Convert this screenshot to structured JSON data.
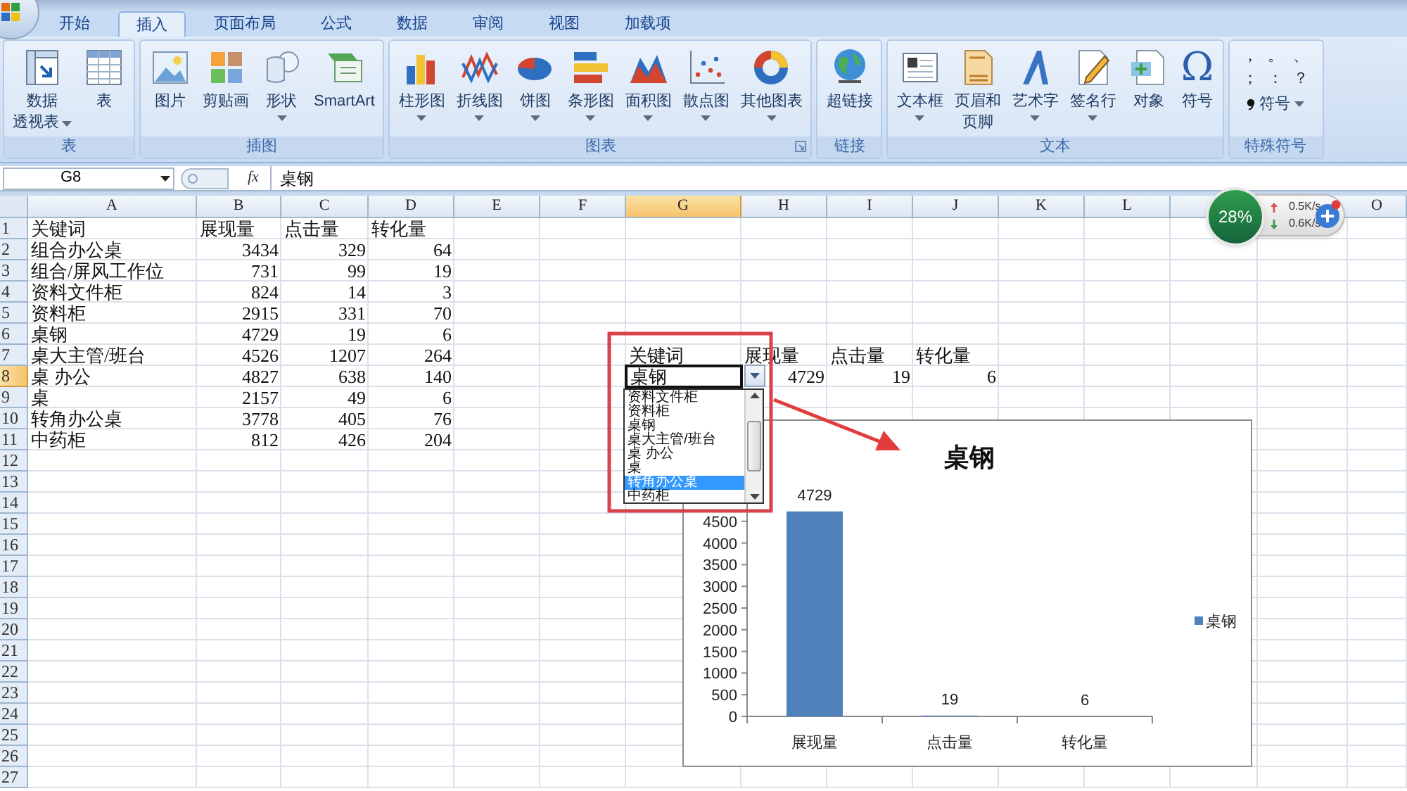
{
  "ribbon": {
    "tabs": [
      {
        "label": "开始",
        "selected": false
      },
      {
        "label": "插入",
        "selected": true
      },
      {
        "label": "页面布局",
        "selected": false
      },
      {
        "label": "公式",
        "selected": false
      },
      {
        "label": "数据",
        "selected": false
      },
      {
        "label": "审阅",
        "selected": false
      },
      {
        "label": "视图",
        "selected": false
      },
      {
        "label": "加载项",
        "selected": false
      }
    ],
    "groups": [
      {
        "label": "表",
        "kind": "buttons",
        "launcher": false,
        "buttons": [
          {
            "lines": [
              "数据",
              "透视表"
            ],
            "dropdown": true
          },
          {
            "lines": [
              "表"
            ],
            "dropdown": false
          }
        ]
      },
      {
        "label": "插图",
        "kind": "buttons",
        "launcher": false,
        "buttons": [
          {
            "lines": [
              "图片"
            ],
            "dropdown": false
          },
          {
            "lines": [
              "剪贴画"
            ],
            "dropdown": false
          },
          {
            "lines": [
              "形状"
            ],
            "dropdown": true
          },
          {
            "lines": [
              "SmartArt"
            ],
            "dropdown": false
          }
        ]
      },
      {
        "label": "图表",
        "kind": "buttons",
        "launcher": true,
        "buttons": [
          {
            "lines": [
              "柱形图"
            ],
            "dropdown": true
          },
          {
            "lines": [
              "折线图"
            ],
            "dropdown": true
          },
          {
            "lines": [
              "饼图"
            ],
            "dropdown": true
          },
          {
            "lines": [
              "条形图"
            ],
            "dropdown": true
          },
          {
            "lines": [
              "面积图"
            ],
            "dropdown": true
          },
          {
            "lines": [
              "散点图"
            ],
            "dropdown": true
          },
          {
            "lines": [
              "其他图表"
            ],
            "dropdown": true
          }
        ]
      },
      {
        "label": "链接",
        "kind": "buttons",
        "launcher": false,
        "buttons": [
          {
            "lines": [
              "超链接"
            ],
            "dropdown": false
          }
        ]
      },
      {
        "label": "文本",
        "kind": "buttons",
        "launcher": false,
        "buttons": [
          {
            "lines": [
              "文本框"
            ],
            "dropdown": true
          },
          {
            "lines": [
              "页眉和",
              "页脚"
            ],
            "dropdown": false
          },
          {
            "lines": [
              "艺术字"
            ],
            "dropdown": true
          },
          {
            "lines": [
              "签名行"
            ],
            "dropdown": true
          },
          {
            "lines": [
              "对象"
            ],
            "dropdown": false
          },
          {
            "lines": [
              "符号"
            ],
            "dropdown": false,
            "glyph": "Ω"
          }
        ]
      },
      {
        "label": "特殊符号",
        "kind": "symbols",
        "launcher": false,
        "symbols": [
          "，",
          "。",
          "、",
          "；",
          "：",
          "？"
        ],
        "button": {
          "label": "符号",
          "dropdown": true
        }
      }
    ]
  },
  "formula_bar": {
    "cell": "G8",
    "function_button": "fx",
    "content": "桌钢"
  },
  "sheet": {
    "columns": [
      {
        "label": "A",
        "selected": false
      },
      {
        "label": "B",
        "selected": false
      },
      {
        "label": "C",
        "selected": false
      },
      {
        "label": "D",
        "selected": false
      },
      {
        "label": "E",
        "selected": false
      },
      {
        "label": "F",
        "selected": false
      },
      {
        "label": "G",
        "selected": true
      },
      {
        "label": "H",
        "selected": false
      },
      {
        "label": "I",
        "selected": false
      },
      {
        "label": "J",
        "selected": false
      },
      {
        "label": "K",
        "selected": false
      },
      {
        "label": "L",
        "selected": false
      },
      {
        "label": "O",
        "selected": false
      }
    ],
    "rows": [
      {
        "label": "1",
        "selected": false,
        "cells": [
          {
            "text": "关键词",
            "kind": "text"
          },
          {
            "text": "展现量",
            "kind": "text"
          },
          {
            "text": "点击量",
            "kind": "text"
          },
          {
            "text": "转化量",
            "kind": "text"
          }
        ]
      },
      {
        "label": "2",
        "selected": false,
        "cells": [
          {
            "text": "组合办公桌",
            "kind": "text"
          },
          {
            "text": "3434",
            "kind": "number"
          },
          {
            "text": "329",
            "kind": "number"
          },
          {
            "text": "64",
            "kind": "number"
          }
        ]
      },
      {
        "label": "3",
        "selected": false,
        "cells": [
          {
            "text": "组合/屏风工作位",
            "kind": "text"
          },
          {
            "text": "731",
            "kind": "number"
          },
          {
            "text": "99",
            "kind": "number"
          },
          {
            "text": "19",
            "kind": "number"
          }
        ]
      },
      {
        "label": "4",
        "selected": false,
        "cells": [
          {
            "text": "资料文件柜",
            "kind": "text"
          },
          {
            "text": "824",
            "kind": "number"
          },
          {
            "text": "14",
            "kind": "number"
          },
          {
            "text": "3",
            "kind": "number"
          }
        ]
      },
      {
        "label": "5",
        "selected": false,
        "cells": [
          {
            "text": "资料柜",
            "kind": "text"
          },
          {
            "text": "2915",
            "kind": "number"
          },
          {
            "text": "331",
            "kind": "number"
          },
          {
            "text": "70",
            "kind": "number"
          }
        ]
      },
      {
        "label": "6",
        "selected": false,
        "cells": [
          {
            "text": "桌钢",
            "kind": "text"
          },
          {
            "text": "4729",
            "kind": "number"
          },
          {
            "text": "19",
            "kind": "number"
          },
          {
            "text": "6",
            "kind": "number"
          }
        ]
      },
      {
        "label": "7",
        "selected": false,
        "cells": [
          {
            "text": "桌大主管/班台",
            "kind": "text"
          },
          {
            "text": "4526",
            "kind": "number"
          },
          {
            "text": "1207",
            "kind": "number"
          },
          {
            "text": "264",
            "kind": "number"
          }
        ]
      },
      {
        "label": "8",
        "selected": true,
        "cells": [
          {
            "text": "桌 办公",
            "kind": "text"
          },
          {
            "text": "4827",
            "kind": "number"
          },
          {
            "text": "638",
            "kind": "number"
          },
          {
            "text": "140",
            "kind": "number"
          }
        ]
      },
      {
        "label": "9",
        "selected": false,
        "cells": [
          {
            "text": "桌",
            "kind": "text"
          },
          {
            "text": "2157",
            "kind": "number"
          },
          {
            "text": "49",
            "kind": "number"
          },
          {
            "text": "6",
            "kind": "number"
          }
        ]
      },
      {
        "label": "10",
        "selected": false,
        "cells": [
          {
            "text": "转角办公桌",
            "kind": "text"
          },
          {
            "text": "3778",
            "kind": "number"
          },
          {
            "text": "405",
            "kind": "number"
          },
          {
            "text": "76",
            "kind": "number"
          }
        ]
      },
      {
        "label": "11",
        "selected": false,
        "cells": [
          {
            "text": "中药柜",
            "kind": "text"
          },
          {
            "text": "812",
            "kind": "number"
          },
          {
            "text": "426",
            "kind": "number"
          },
          {
            "text": "204",
            "kind": "number"
          }
        ]
      },
      {
        "label": "12",
        "selected": false
      },
      {
        "label": "13",
        "selected": false
      },
      {
        "label": "14",
        "selected": false
      },
      {
        "label": "15",
        "selected": false
      },
      {
        "label": "16",
        "selected": false
      },
      {
        "label": "17",
        "selected": false
      },
      {
        "label": "18",
        "selected": false
      },
      {
        "label": "19",
        "selected": false
      },
      {
        "label": "20",
        "selected": false
      },
      {
        "label": "21",
        "selected": false
      },
      {
        "label": "22",
        "selected": false
      },
      {
        "label": "23",
        "selected": false
      },
      {
        "label": "24",
        "selected": false
      },
      {
        "label": "25",
        "selected": false
      },
      {
        "label": "26",
        "selected": false
      },
      {
        "label": "27",
        "selected": false
      }
    ]
  },
  "lookup_table": {
    "headers": [
      "关键词",
      "展现量",
      "点击量",
      "转化量"
    ],
    "keyword": "桌钢",
    "values": [
      "4729",
      "19",
      "6"
    ]
  },
  "dropdown_list": {
    "items": [
      {
        "label": "资料文件柜",
        "selected": false
      },
      {
        "label": "资料柜",
        "selected": false
      },
      {
        "label": "桌钢",
        "selected": false
      },
      {
        "label": "桌大主管/班台",
        "selected": false
      },
      {
        "label": "桌 办公",
        "selected": false
      },
      {
        "label": "桌",
        "selected": false
      },
      {
        "label": "转角办公桌",
        "selected": true
      },
      {
        "label": "中药柜",
        "selected": false
      }
    ]
  },
  "chart": {
    "chart_data": {
      "type": "bar",
      "title": "桌钢",
      "categories": [
        "展现量",
        "点击量",
        "转化量"
      ],
      "series": [
        {
          "name": "桌钢",
          "color": "#4f81bd",
          "values": [
            4729,
            19,
            6
          ]
        }
      ],
      "ylim": [
        0,
        5000
      ],
      "yticks": [
        0,
        500,
        1000,
        1500,
        2000,
        2500,
        3000,
        3500,
        4000,
        4500
      ],
      "data_labels": true
    }
  },
  "net_monitor": {
    "usage": "28%",
    "upload_speed": "0.5K/s",
    "download_speed": "0.6K/s"
  }
}
